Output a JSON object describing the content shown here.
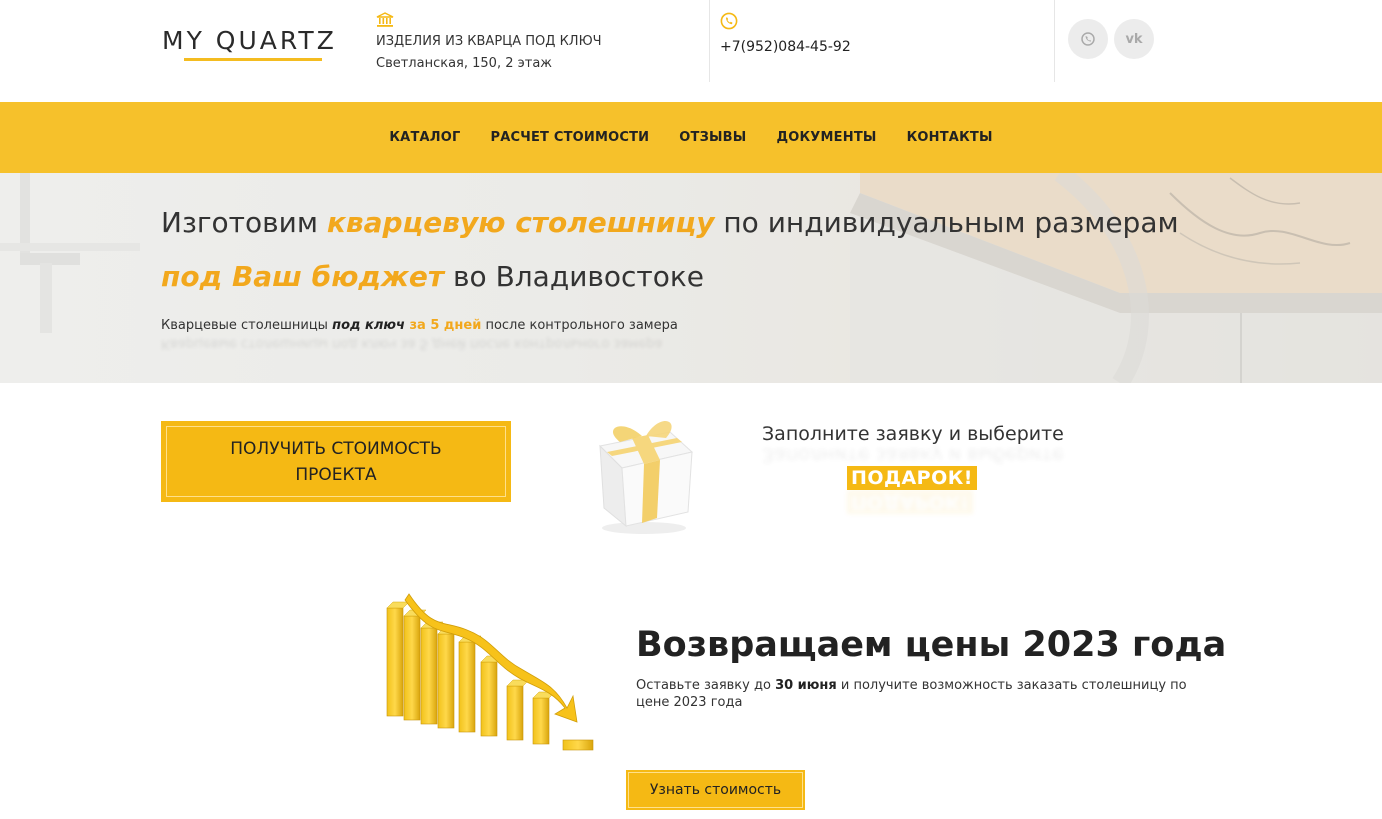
{
  "header": {
    "logo_text": "MY QUARTZ",
    "company_tagline": "ИЗДЕЛИЯ ИЗ КВАРЦА ПОД КЛЮЧ",
    "address": "Светланская, 150, 2 этаж",
    "phone": "+7(952)084-45-92",
    "social": [
      {
        "name": "whatsapp-icon",
        "glyph": "✆"
      },
      {
        "name": "vk-icon",
        "glyph": "vk"
      }
    ]
  },
  "nav": {
    "items": [
      "КАТАЛОГ",
      "РАСЧЕТ СТОИМОСТИ",
      "ОТЗЫВЫ",
      "ДОКУМЕНТЫ",
      "КОНТАКТЫ"
    ]
  },
  "hero": {
    "line1_pre": "Изготовим ",
    "line1_accent": "кварцевую столешницу",
    "line1_post": " по индивидуальным размерам",
    "line2_accent": "под Ваш бюджет",
    "line2_post": " во Владивостоке",
    "sub_pre": "Кварцевые столешницы ",
    "sub_bold": "под ключ",
    "sub_orange": " за 5 дней",
    "sub_post": " после контрольного замера"
  },
  "cta": {
    "button_line1": "ПОЛУЧИТЬ СТОИМОСТЬ",
    "button_line2": "ПРОЕКТА",
    "gift_text": "Заполните заявку и выберите",
    "gift_badge": "ПОДАРОК!"
  },
  "price": {
    "title": "Возвращаем цены 2023 года",
    "desc_pre": "Оставьте заявку до ",
    "desc_bold": "30 июня",
    "desc_post": " и получите возможность заказать столешницу по цене 2023 года",
    "button": "Узнать стоимость"
  },
  "colors": {
    "accent": "#f6c12b",
    "accent_text": "#f2a81d",
    "button": "#f5b914"
  }
}
